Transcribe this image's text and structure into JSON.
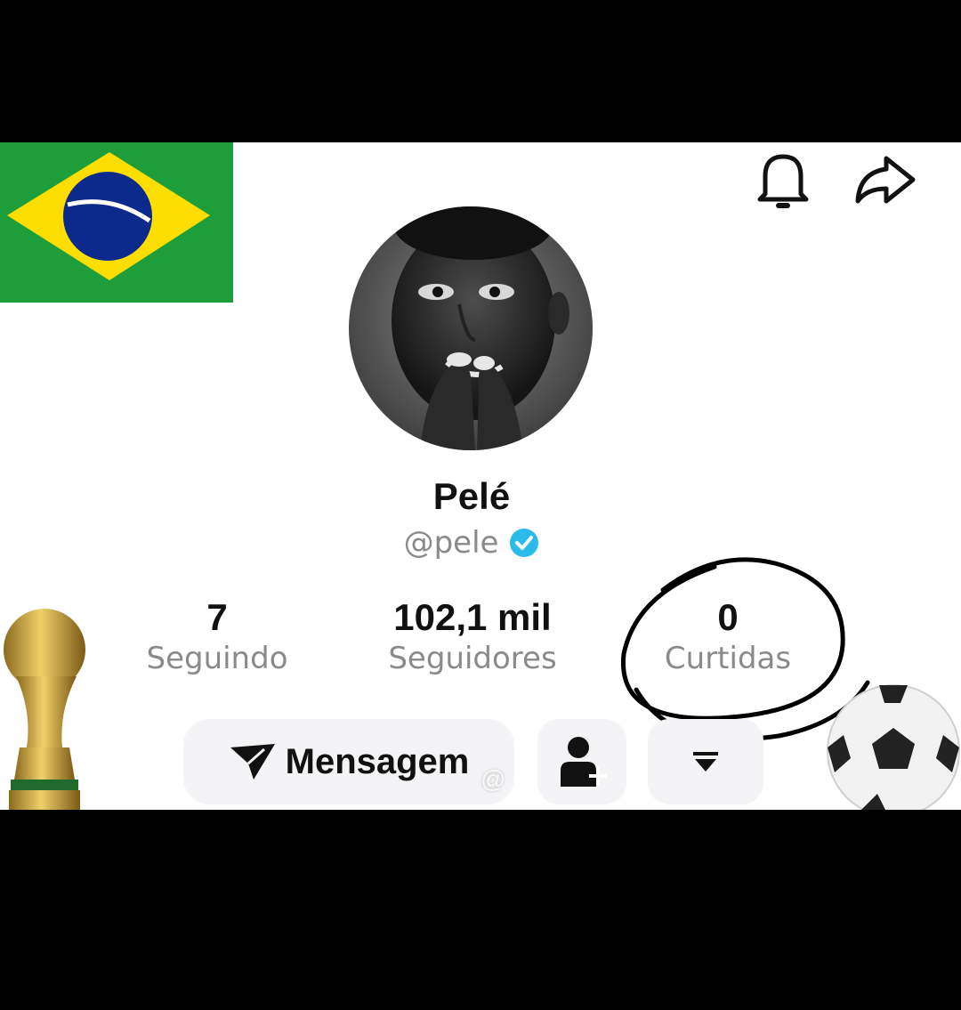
{
  "profile": {
    "name": "Pelé",
    "handle": "@pele",
    "verified": true
  },
  "stats": {
    "following": {
      "value": "7",
      "label": "Seguindo"
    },
    "followers": {
      "value": "102,1 mil",
      "label": "Seguidores"
    },
    "likes": {
      "value": "0",
      "label": "Curtidas"
    }
  },
  "actions": {
    "message_label": "Mensagem"
  },
  "watermark": "@",
  "icons": [
    "bell-icon",
    "share-icon",
    "send-icon",
    "add-user-icon",
    "dropdown-icon",
    "verified-badge-icon",
    "brazil-flag",
    "world-cup-trophy",
    "soccer-ball"
  ],
  "colors": {
    "verified": "#2BBBEA",
    "flag_green": "#1E9E3A",
    "flag_yellow": "#FEDD00",
    "flag_blue": "#0B2A8C",
    "annotation_circle": "#000000"
  }
}
